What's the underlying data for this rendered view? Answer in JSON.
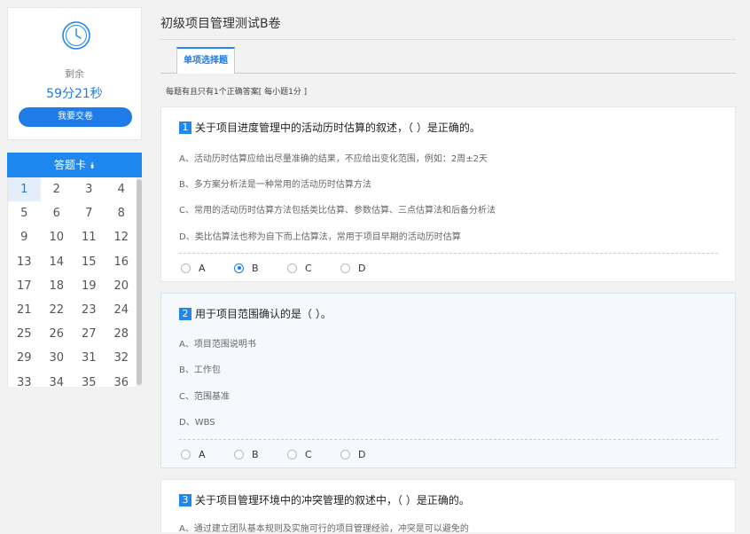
{
  "timer": {
    "remain_label": "剩余",
    "remain_time": "59分21秒",
    "submit_label": "我要交卷",
    "icon": "clock-icon"
  },
  "answer_card": {
    "title": "答题卡",
    "chevron_icon": "chevron-double-down-icon",
    "numbers": [
      "1",
      "2",
      "3",
      "4",
      "5",
      "6",
      "7",
      "8",
      "9",
      "10",
      "11",
      "12",
      "13",
      "14",
      "15",
      "16",
      "17",
      "18",
      "19",
      "20",
      "21",
      "22",
      "23",
      "24",
      "25",
      "26",
      "27",
      "28",
      "29",
      "30",
      "31",
      "32",
      "33",
      "34",
      "35",
      "36"
    ],
    "active": "1"
  },
  "exam": {
    "title": "初级项目管理测试B卷",
    "tab_label": "单项选择题",
    "instruction": "每题有且只有1个正确答案[ 每小题1分 ]"
  },
  "questions": [
    {
      "num": "1",
      "text": "关于项目进度管理中的活动历时估算的叙述，（   ）是正确的。",
      "options": [
        "A、活动历时估算应给出尽量准确的结果，不应给出变化范围，例如：2周±2天",
        "B、多方案分析法是一种常用的活动历时估算方法",
        "C、常用的活动历时估算方法包括类比估算、参数估算、三点估算法和后备分析法",
        "D、类比估算法也称为自下而上估算法，常用于项目早期的活动历时估算"
      ],
      "choices": [
        "A",
        "B",
        "C",
        "D"
      ],
      "selected": "B"
    },
    {
      "num": "2",
      "text": "用于项目范围确认的是（  ）。",
      "options": [
        "A、项目范围说明书",
        "B、工作包",
        "C、范围基准",
        "D、WBS"
      ],
      "choices": [
        "A",
        "B",
        "C",
        "D"
      ],
      "selected": ""
    },
    {
      "num": "3",
      "text": "关于项目管理环境中的冲突管理的叙述中，（   ）是正确的。",
      "options": [
        "A、通过建立团队基本规则及实施可行的项目管理经验，冲突是可以避免的"
      ],
      "choices": [],
      "selected": ""
    }
  ],
  "colors": {
    "accent": "#1e7be8",
    "header_blue": "#1e88f0"
  }
}
